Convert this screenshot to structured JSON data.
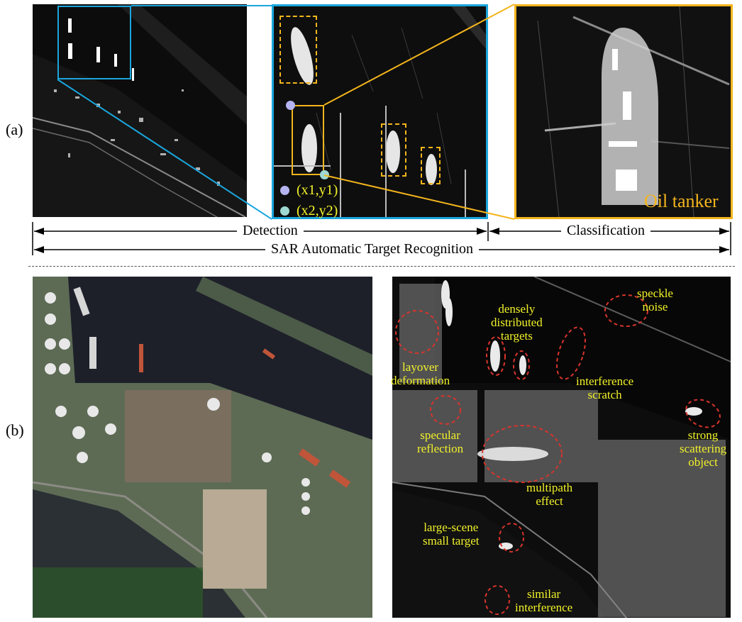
{
  "panels": {
    "a_label": "(a)",
    "b_label": "(b)"
  },
  "coords": {
    "p1": "(x1,y1)",
    "p2": "(x2,y2)"
  },
  "classification_result": "Oil tanker",
  "arrows": {
    "detection": "Detection",
    "classification": "Classification",
    "sar_atr": "SAR Automatic Target Recognition"
  },
  "annotations": {
    "speckle_noise": [
      "speckle",
      "noise"
    ],
    "densely_distributed": [
      "densely",
      "distributed",
      "targets"
    ],
    "layover": [
      "layover",
      "deformation"
    ],
    "interference_scratch": [
      "interference",
      "scratch"
    ],
    "specular": [
      "specular",
      "reflection"
    ],
    "strong_scattering": [
      "strong",
      "scattering",
      "object"
    ],
    "multipath": [
      "multipath",
      "effect"
    ],
    "large_scene": [
      "large-scene",
      "small target"
    ],
    "similar_interference": [
      "similar",
      "interference"
    ]
  },
  "colors": {
    "zoom_box": "#1aa6dd",
    "target_box": "#f4b51d",
    "annotation_text": "#f2f22a",
    "annotation_ellipse": "#d8342c",
    "point1": "#b6b4f0",
    "point2": "#9fd8d2"
  }
}
